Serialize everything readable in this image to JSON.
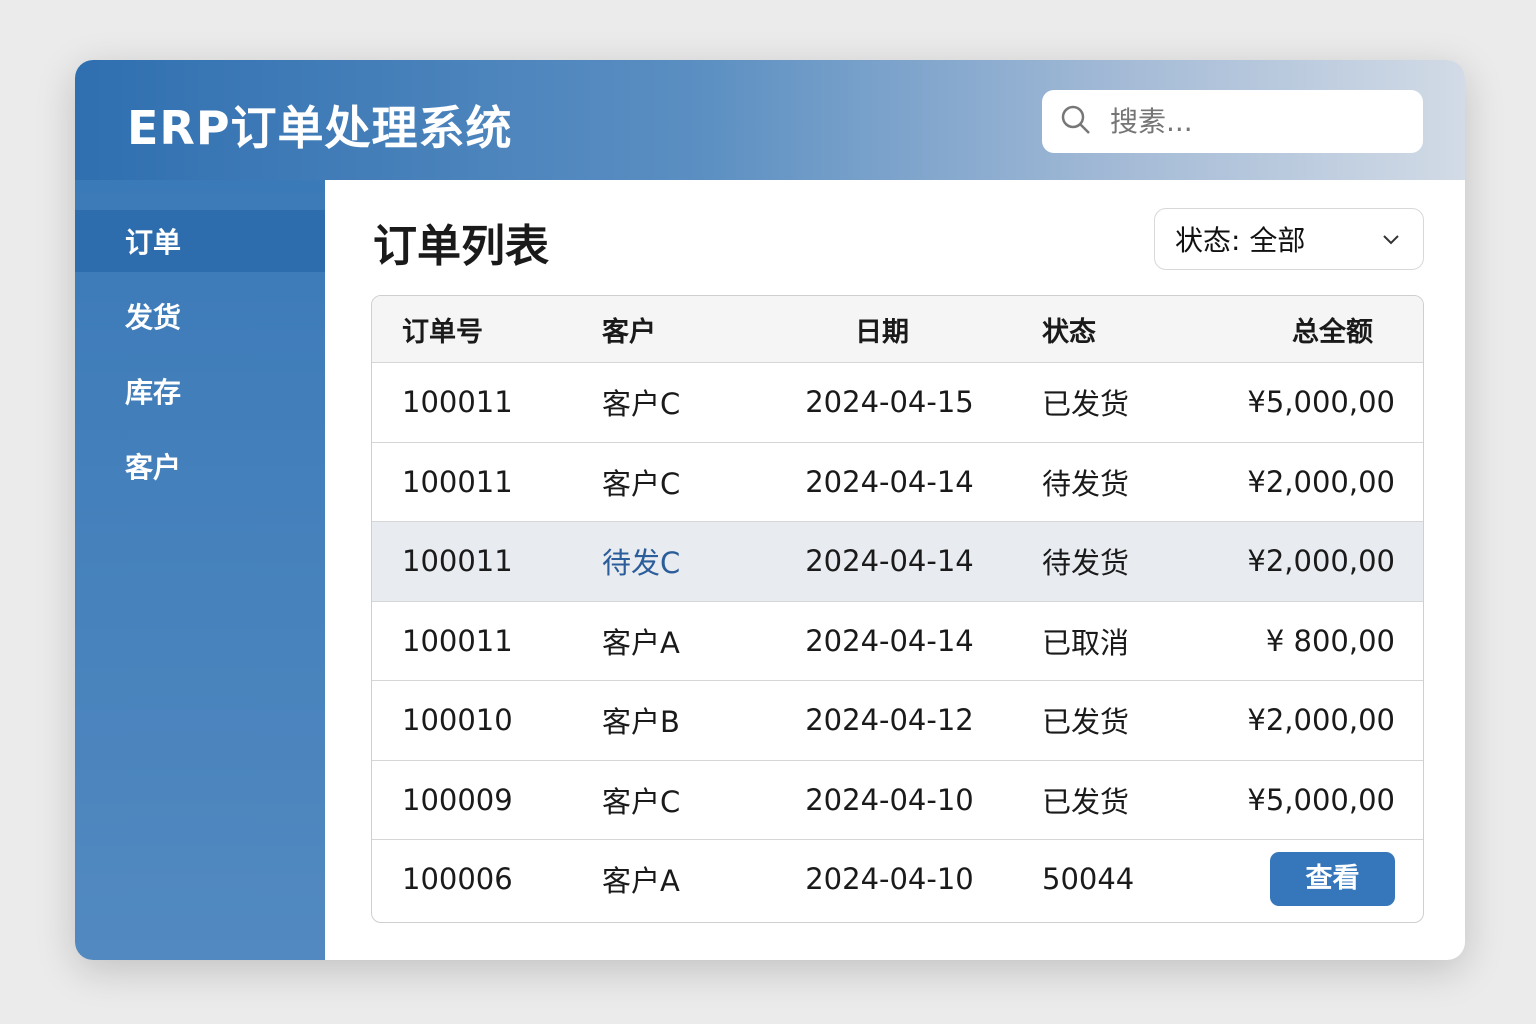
{
  "app": {
    "title": "ERP订单处理系统"
  },
  "search": {
    "placeholder": "搜素..."
  },
  "sidebar": {
    "items": [
      {
        "label": "订单"
      },
      {
        "label": "发货"
      },
      {
        "label": "库存"
      },
      {
        "label": "客户"
      }
    ]
  },
  "main": {
    "title": "订单列表",
    "filter": "状态: 全部"
  },
  "table": {
    "headers": [
      "订单号",
      "客户",
      "日期",
      "状态",
      "总全额"
    ],
    "rows": [
      [
        "100011",
        "客户C",
        "2024-04-15",
        "已发货",
        "¥5,000,00"
      ],
      [
        "100011",
        "客户C",
        "2024-04-14",
        "待发货",
        "¥2,000,00"
      ],
      [
        "100011",
        "待发C",
        "2024-04-14",
        "待发货",
        "¥2,000,00"
      ],
      [
        "100011",
        "客户A",
        "2024-04-14",
        "已取消",
        "¥ 800,00"
      ],
      [
        "100010",
        "客户B",
        "2024-04-12",
        "已发货",
        "¥2,000,00"
      ],
      [
        "100009",
        "客户C",
        "2024-04-10",
        "已发货",
        "¥5,000,00"
      ],
      [
        "100006",
        "客户A",
        "2024-04-10",
        "50044",
        ""
      ]
    ],
    "view_button": "查看"
  }
}
